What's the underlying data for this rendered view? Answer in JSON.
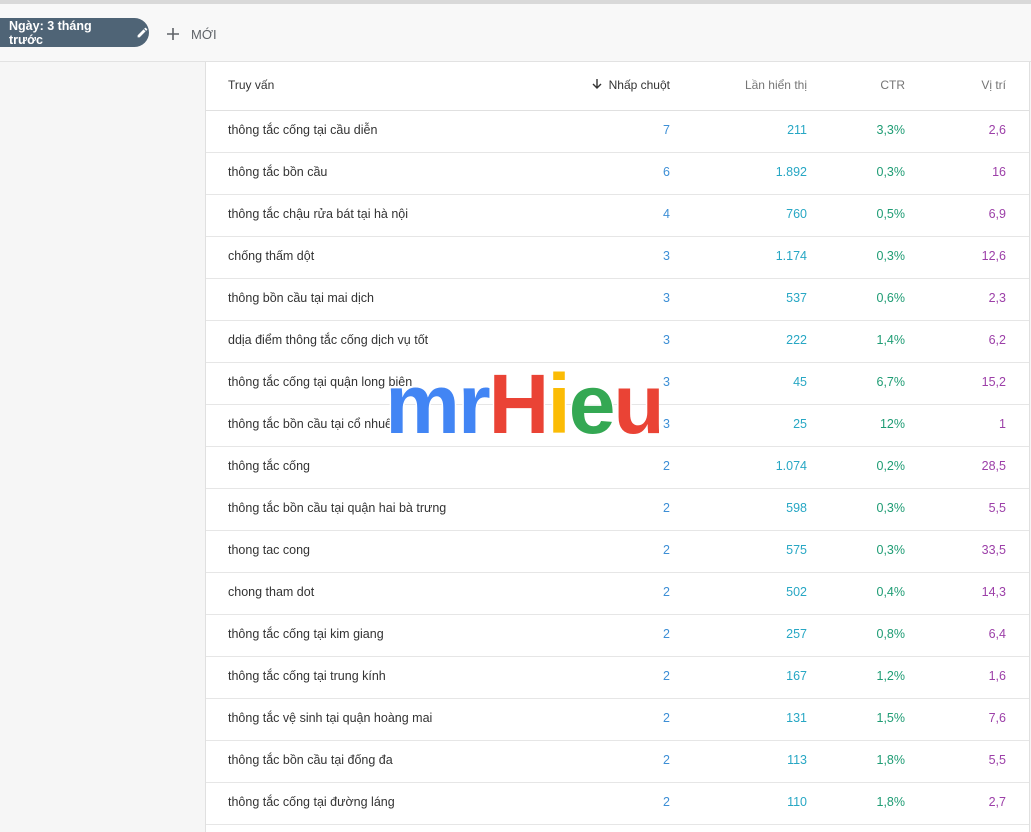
{
  "filter": {
    "date_label": "Ngày: 3 tháng trước",
    "new_label": "MỚI"
  },
  "table": {
    "headers": {
      "query": "Truy vấn",
      "clicks": "Nhấp chuột",
      "impressions": "Lần hiển thị",
      "ctr": "CTR",
      "position": "Vị trí"
    },
    "rows": [
      {
        "query": "thông tắc cống tại cầu diễn",
        "clicks": "7",
        "impressions": "211",
        "ctr": "3,3%",
        "position": "2,6"
      },
      {
        "query": "thông tắc bồn cầu",
        "clicks": "6",
        "impressions": "1.892",
        "ctr": "0,3%",
        "position": "16"
      },
      {
        "query": "thông tắc chậu rửa bát tại hà nội",
        "clicks": "4",
        "impressions": "760",
        "ctr": "0,5%",
        "position": "6,9"
      },
      {
        "query": "chống thấm dột",
        "clicks": "3",
        "impressions": "1.174",
        "ctr": "0,3%",
        "position": "12,6"
      },
      {
        "query": "thông bồn cầu tại mai dịch",
        "clicks": "3",
        "impressions": "537",
        "ctr": "0,6%",
        "position": "2,3"
      },
      {
        "query": "ddịa điểm thông tắc cống dịch vụ tốt",
        "clicks": "3",
        "impressions": "222",
        "ctr": "1,4%",
        "position": "6,2"
      },
      {
        "query": "thông tắc cống tại quận long biên",
        "clicks": "3",
        "impressions": "45",
        "ctr": "6,7%",
        "position": "15,2"
      },
      {
        "query": "thông tắc bồn cầu tại cổ nhuế",
        "clicks": "3",
        "impressions": "25",
        "ctr": "12%",
        "position": "1"
      },
      {
        "query": "thông tắc cống",
        "clicks": "2",
        "impressions": "1.074",
        "ctr": "0,2%",
        "position": "28,5"
      },
      {
        "query": "thông tắc bồn cầu tại quận hai bà trưng",
        "clicks": "2",
        "impressions": "598",
        "ctr": "0,3%",
        "position": "5,5"
      },
      {
        "query": "thong tac cong",
        "clicks": "2",
        "impressions": "575",
        "ctr": "0,3%",
        "position": "33,5"
      },
      {
        "query": "chong tham dot",
        "clicks": "2",
        "impressions": "502",
        "ctr": "0,4%",
        "position": "14,3"
      },
      {
        "query": "thông tắc cống tại kim giang",
        "clicks": "2",
        "impressions": "257",
        "ctr": "0,8%",
        "position": "6,4"
      },
      {
        "query": "thông tắc cống tại trung kính",
        "clicks": "2",
        "impressions": "167",
        "ctr": "1,2%",
        "position": "1,6"
      },
      {
        "query": "thông tắc vệ sinh tại quận hoàng mai",
        "clicks": "2",
        "impressions": "131",
        "ctr": "1,5%",
        "position": "7,6"
      },
      {
        "query": "thông tắc bồn cầu tại đống đa",
        "clicks": "2",
        "impressions": "113",
        "ctr": "1,8%",
        "position": "5,5"
      },
      {
        "query": "thông tắc cống tại đường láng",
        "clicks": "2",
        "impressions": "110",
        "ctr": "1,8%",
        "position": "2,7"
      }
    ]
  },
  "watermark": {
    "letters": [
      "m",
      "r",
      "H",
      "i",
      "e",
      "u"
    ]
  },
  "colors": {
    "clicks": "#3d8fd6",
    "impressions": "#27a7c4",
    "ctr": "#1e9c74",
    "position": "#9c3fa8",
    "chip_bg": "#4f6476",
    "wm_blue": "#4285f4",
    "wm_red": "#ea4335",
    "wm_yellow": "#fbbc05",
    "wm_green": "#34a853"
  }
}
